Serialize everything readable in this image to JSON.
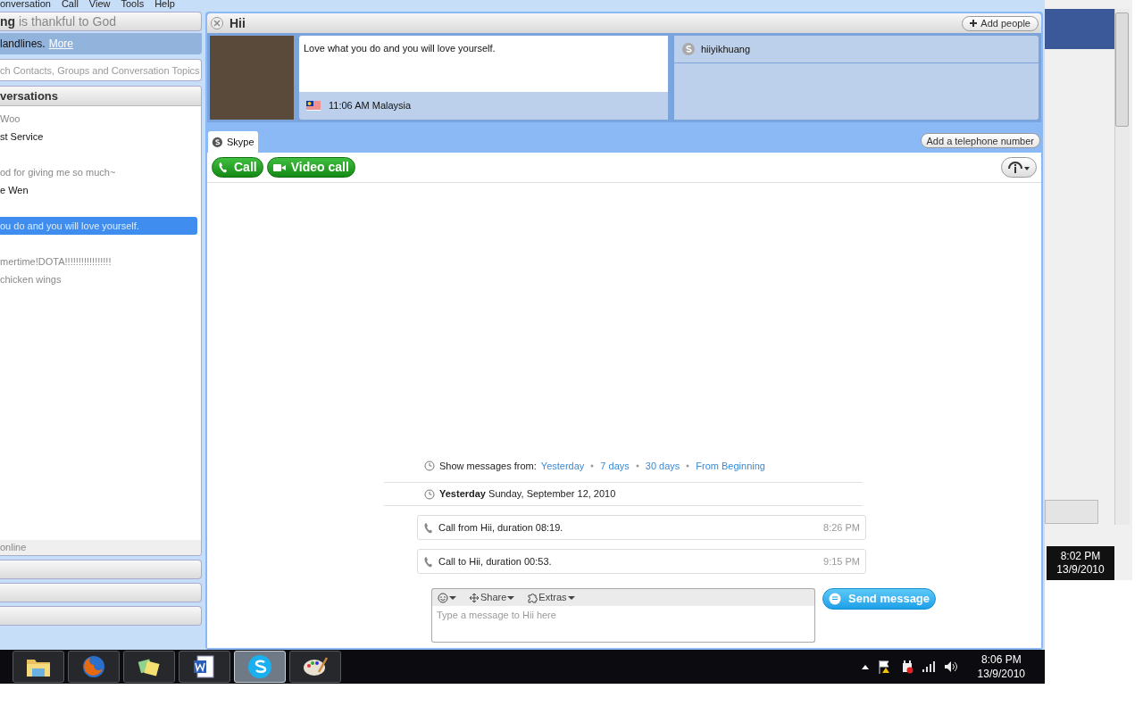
{
  "menu_bar": {
    "items": [
      "onversation",
      "Call",
      "View",
      "Tools",
      "Help"
    ]
  },
  "sidebar": {
    "status": {
      "name": "ng",
      "mood": "is thankful to God"
    },
    "promo": {
      "text": "landlines.",
      "link": "More"
    },
    "search": {
      "placeholder": "ch Contacts, Groups and Conversation Topics"
    },
    "conversations": {
      "title": "versations",
      "groups": [
        [
          {
            "text": "Woo",
            "muted": true,
            "selected": false
          },
          {
            "text": "st Service",
            "muted": false,
            "selected": false
          }
        ],
        [
          {
            "text": "od for giving me so much~",
            "muted": true,
            "selected": false
          },
          {
            "text": "e Wen",
            "muted": false,
            "selected": false
          }
        ],
        [
          {
            "text": "ou do and you will love yourself.",
            "selected": true
          }
        ],
        [
          {
            "text": "mertime!DOTA!!!!!!!!!!!!!!!!!",
            "muted": true,
            "selected": false
          },
          {
            "text": "chicken wings",
            "muted": true,
            "selected": false
          }
        ]
      ],
      "footer": "online"
    }
  },
  "conversation": {
    "title": "Hii",
    "add_people": "Add people",
    "mood": "Love what you do and you will love yourself.",
    "local_time": "11:06 AM Malaysia",
    "skype_name": "hiiyikhuang",
    "tabs": [
      {
        "label": "Skype",
        "selected": true
      }
    ],
    "add_phone": "Add a telephone number",
    "call_buttons": [
      {
        "kind": "call",
        "label": "Call"
      },
      {
        "kind": "video",
        "label": "Video call"
      }
    ],
    "history": {
      "show_from_label": "Show messages from:",
      "ranges": [
        "Yesterday",
        "7 days",
        "30 days",
        "From Beginning"
      ],
      "day": {
        "label": "Yesterday",
        "date": "Sunday, September 12, 2010"
      },
      "events": [
        {
          "text": "Call from Hii, duration 08:19.",
          "time": "8:26 PM"
        },
        {
          "text": "Call to Hii, duration 00:53.",
          "time": "9:15 PM"
        }
      ]
    },
    "composer": {
      "tools": [
        {
          "kind": "emoticon"
        },
        {
          "kind": "share",
          "label": "Share"
        },
        {
          "kind": "extras",
          "label": "Extras"
        }
      ],
      "placeholder": "Type a message to Hii here"
    },
    "send": "Send message"
  },
  "side_window": {
    "clock": {
      "time": "8:02 PM",
      "date": "13/9/2010"
    }
  },
  "taskbar": {
    "apps": [
      {
        "kind": "folder",
        "selected": false
      },
      {
        "kind": "browser",
        "selected": false
      },
      {
        "kind": "notes",
        "selected": false
      },
      {
        "kind": "word",
        "selected": false
      },
      {
        "kind": "skype",
        "selected": true
      },
      {
        "kind": "paint",
        "selected": false
      }
    ],
    "clock": {
      "time": "8:06 PM",
      "date": "13/9/2010"
    }
  }
}
